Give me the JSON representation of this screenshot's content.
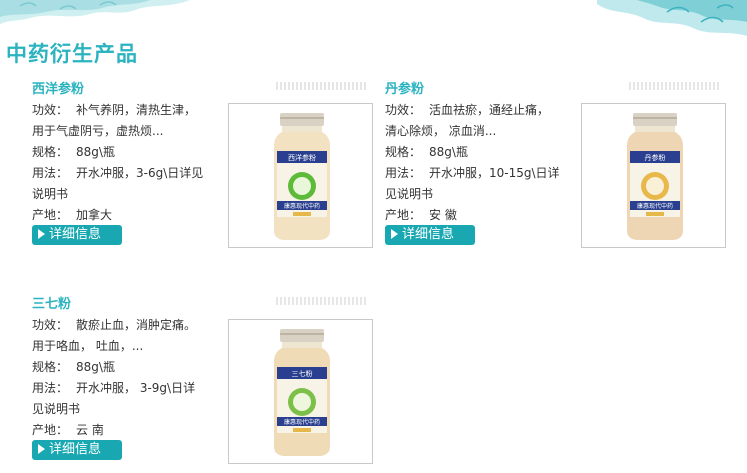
{
  "header": {
    "title": "中药衍生产品"
  },
  "labels": {
    "efficacy": "功效：",
    "spec": "规格：",
    "usage": "用法：",
    "origin": "产地：",
    "detail_button": "详细信息"
  },
  "products": [
    {
      "name": "西洋参粉",
      "efficacy": "补气养阴，清热生津，",
      "efficacy_more": "用于气虚阴亏，虚热烦...",
      "spec": "88g\\瓶",
      "usage": "开水冲服，3-6g\\日详见",
      "usage_more": "说明书",
      "origin": "加拿大",
      "jar_label": "西洋参粉",
      "jar_band": "康惠现代中药",
      "label_color": "#5dbb3a"
    },
    {
      "name": "丹参粉",
      "efficacy": "活血祛瘀，通经止痛，",
      "efficacy_more": "清心除烦， 凉血消...",
      "spec": "88g\\瓶",
      "usage": "开水冲服，10-15g\\日详",
      "usage_more": "见说明书",
      "origin": "安 徽",
      "jar_label": "丹参粉",
      "jar_band": "康惠现代中药",
      "label_color": "#e8b84a"
    },
    {
      "name": "三七粉",
      "efficacy": "散瘀止血，消肿定痛。",
      "efficacy_more": "用于咯血， 吐血，...",
      "spec": "88g\\瓶",
      "usage": "开水冲服， 3-9g\\日详",
      "usage_more": "见说明书",
      "origin": "云 南",
      "jar_label": "三七粉",
      "jar_band": "康惠现代中药",
      "label_color": "#7cc04a"
    }
  ],
  "colors": {
    "accent": "#2bb3c0",
    "button": "#19a8b1",
    "jar_band": "#2a3f8f"
  }
}
